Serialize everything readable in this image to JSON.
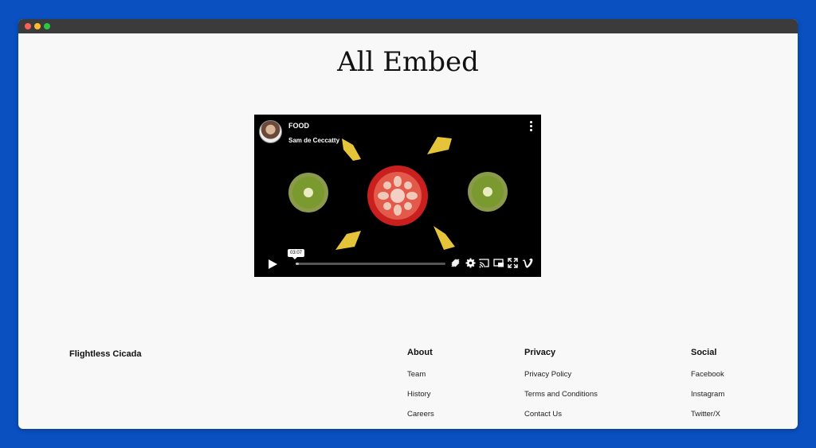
{
  "page": {
    "title": "All Embed"
  },
  "video": {
    "title": "FOOD",
    "author": "Sam de Ceccatty",
    "timecode": "03:07",
    "progress": 0.02
  },
  "footer": {
    "brand": "Flightless Cicada",
    "columns": [
      {
        "heading": "About",
        "links": [
          "Team",
          "History",
          "Careers"
        ]
      },
      {
        "heading": "Privacy",
        "links": [
          "Privacy Policy",
          "Terms and Conditions",
          "Contact Us"
        ]
      },
      {
        "heading": "Social",
        "links": [
          "Facebook",
          "Instagram",
          "Twitter/X"
        ]
      }
    ]
  },
  "colors": {
    "background": "#0a50c0",
    "window": "#f8f8f8",
    "titlebar": "#3b3b3b"
  },
  "icons": [
    "play-icon",
    "kebab-menu-icon",
    "hd-off-icon",
    "gear-icon",
    "cast-icon",
    "pip-icon",
    "fullscreen-icon",
    "vimeo-logo-icon"
  ]
}
